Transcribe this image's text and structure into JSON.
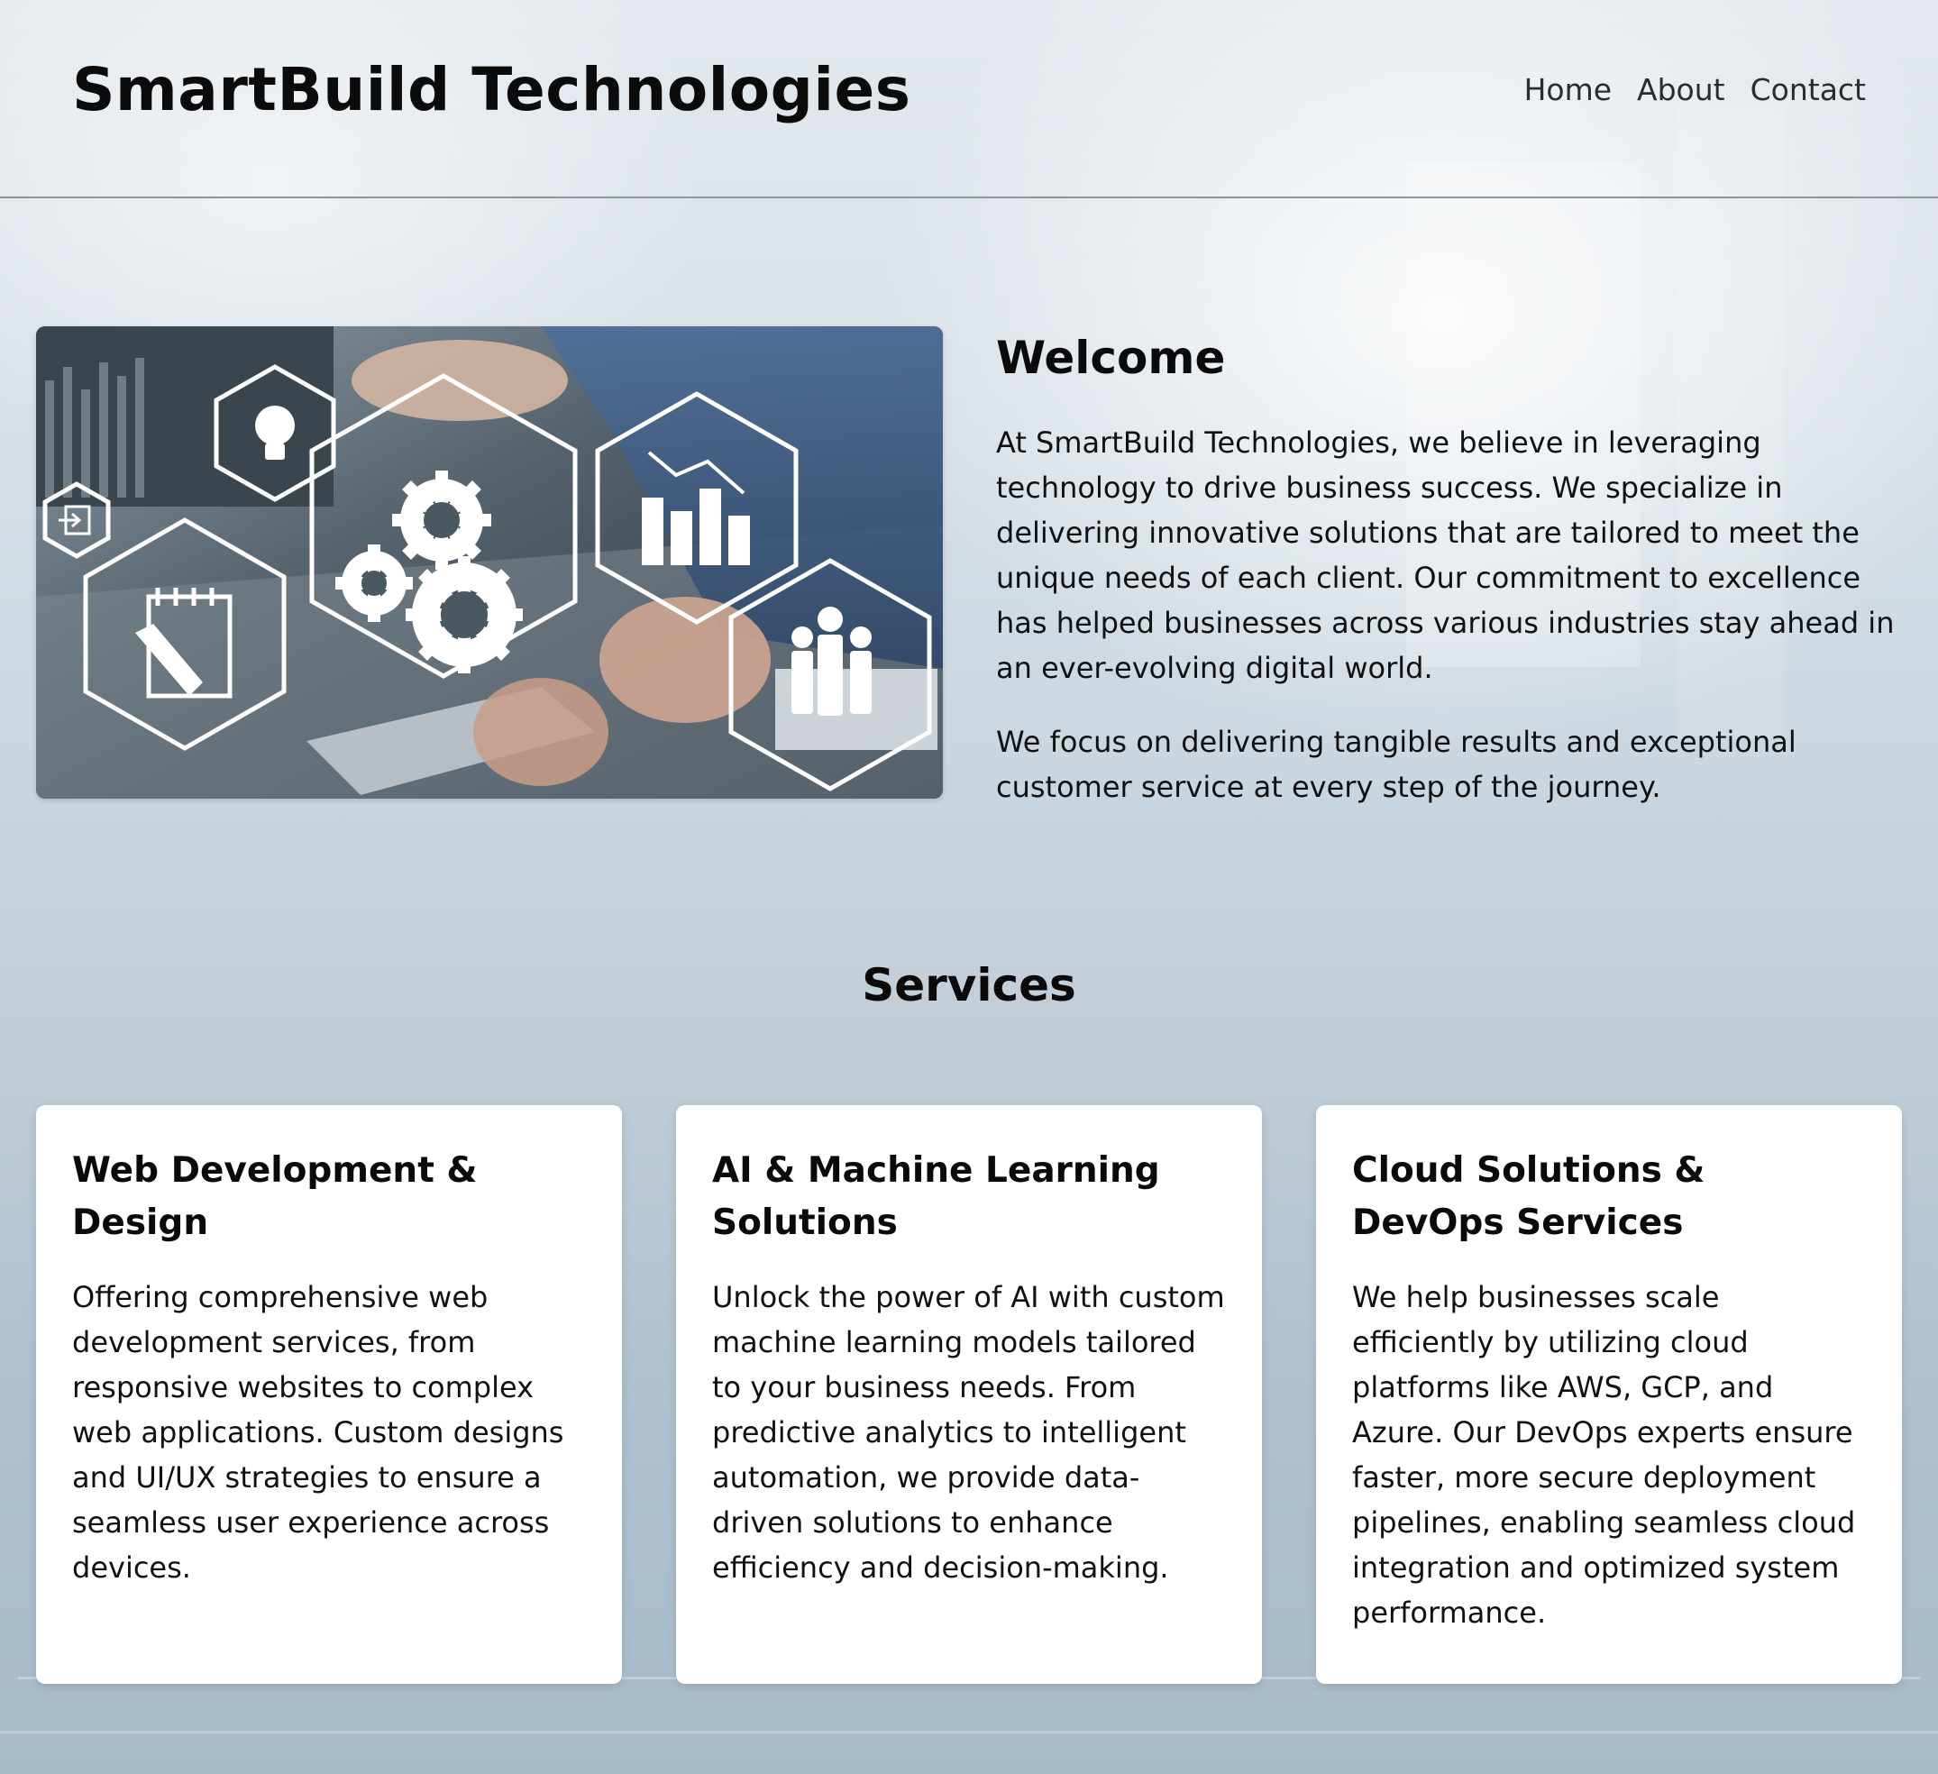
{
  "header": {
    "brand": "SmartBuild Technologies",
    "nav": [
      {
        "label": "Home"
      },
      {
        "label": "About"
      },
      {
        "label": "Contact"
      }
    ]
  },
  "hero": {
    "image_icons": [
      "lightbulb-icon",
      "gears-icon",
      "bar-chart-icon",
      "people-icon",
      "notepad-pencil-icon",
      "login-icon"
    ]
  },
  "welcome": {
    "title": "Welcome",
    "paragraph1": "At SmartBuild Technologies, we believe in leveraging technology to drive business success. We specialize in delivering innovative solutions that are tailored to meet the unique needs of each client. Our commitment to excellence has helped businesses across various industries stay ahead in an ever-evolving digital world.",
    "paragraph2": "We focus on delivering tangible results and exceptional customer service at every step of the journey."
  },
  "services": {
    "title": "Services",
    "cards": [
      {
        "title": "Web Development & Design",
        "body": "Offering comprehensive web development services, from responsive websites to complex web applications. Custom designs and UI/UX strategies to ensure a seamless user experience across devices."
      },
      {
        "title": "AI & Machine Learning Solutions",
        "body": "Unlock the power of AI with custom machine learning models tailored to your business needs. From predictive analytics to intelligent automation, we provide data-driven solutions to enhance efficiency and decision-making."
      },
      {
        "title": "Cloud Solutions & DevOps Services",
        "body": "We help businesses scale efficiently by utilizing cloud platforms like AWS, GCP, and Azure. Our DevOps experts ensure faster, more secure deployment pipelines, enabling seamless cloud integration and optimized system performance."
      }
    ]
  }
}
